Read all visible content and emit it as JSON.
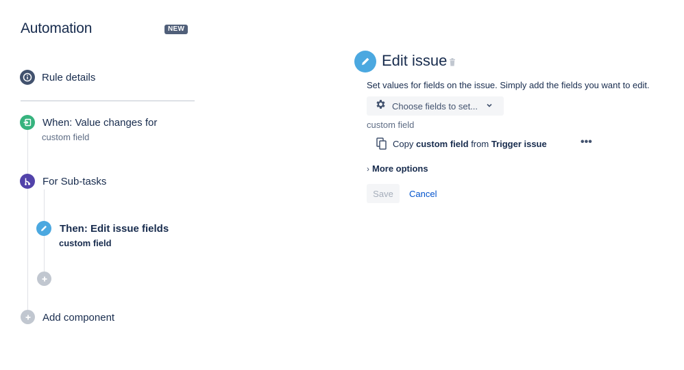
{
  "sidebar": {
    "title": "Automation",
    "badge": "NEW",
    "rule_details": "Rule details",
    "trigger": {
      "label": "When: Value changes for",
      "sub": "custom field"
    },
    "branch": {
      "label": "For Sub-tasks"
    },
    "action": {
      "label": "Then: Edit issue fields",
      "sub": "custom field"
    },
    "add_component": "Add component"
  },
  "editor": {
    "title": "Edit issue",
    "description": "Set values for fields on the issue. Simply add the fields you want to edit.",
    "choose_fields": "Choose fields to set...",
    "field_label": "custom field",
    "copy_row": {
      "copy": "Copy",
      "field": "custom field",
      "from": "from",
      "source": "Trigger issue"
    },
    "more_options": "More options",
    "save": "Save",
    "cancel": "Cancel"
  },
  "colors": {
    "text": "#172B4D",
    "link": "#0052CC",
    "trigger": "#36B37E",
    "branch": "#5243AA",
    "action": "#4BA8E0",
    "info": "#42526E",
    "badge": "#505F79"
  },
  "icons": [
    "info-icon",
    "trigger-icon",
    "branch-icon",
    "pencil-icon",
    "plus-icon",
    "trash-icon",
    "gear-icon",
    "chevron-down-icon",
    "copy-icon",
    "more-icon",
    "chevron-right-icon"
  ]
}
